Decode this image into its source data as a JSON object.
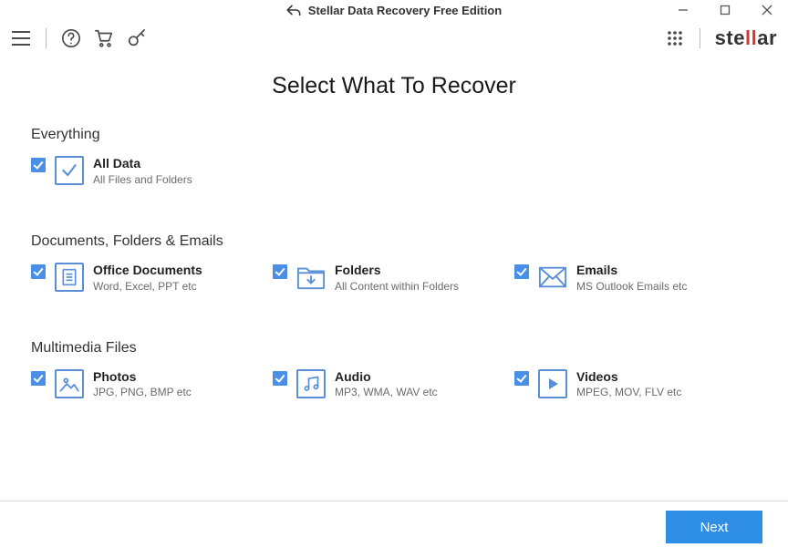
{
  "window": {
    "title": "Stellar Data Recovery Free Edition"
  },
  "page": {
    "heading": "Select What To Recover"
  },
  "sections": {
    "everything": {
      "heading": "Everything",
      "all_data": {
        "title": "All Data",
        "sub": "All Files and Folders"
      }
    },
    "dfe": {
      "heading": "Documents, Folders & Emails",
      "office": {
        "title": "Office Documents",
        "sub": "Word, Excel, PPT etc"
      },
      "folders": {
        "title": "Folders",
        "sub": "All Content within Folders"
      },
      "emails": {
        "title": "Emails",
        "sub": "MS Outlook Emails etc"
      }
    },
    "media": {
      "heading": "Multimedia Files",
      "photos": {
        "title": "Photos",
        "sub": "JPG, PNG, BMP etc"
      },
      "audio": {
        "title": "Audio",
        "sub": "MP3, WMA, WAV etc"
      },
      "videos": {
        "title": "Videos",
        "sub": "MPEG, MOV, FLV etc"
      }
    }
  },
  "footer": {
    "next": "Next"
  },
  "brand": {
    "pre": "ste",
    "mid": "ll",
    "post": "ar"
  }
}
